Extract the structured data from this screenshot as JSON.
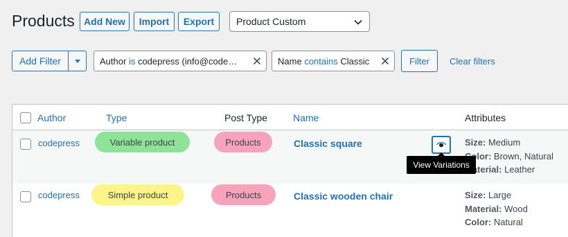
{
  "header": {
    "title": "Products",
    "add_new": "Add New",
    "import": "Import",
    "export": "Export",
    "view_select": "Product Custom"
  },
  "filters": {
    "add_filter": "Add Filter",
    "chips": [
      {
        "field": "Author",
        "operator": "is",
        "value": "codepress (info@code…"
      },
      {
        "field": "Name",
        "operator": "contains",
        "value": "Classic"
      }
    ],
    "filter_button": "Filter",
    "clear_filters": "Clear filters"
  },
  "table": {
    "columns": [
      "Author",
      "Type",
      "Post Type",
      "Name",
      "Attributes"
    ],
    "rows": [
      {
        "author": "codepress",
        "type": "Variable product",
        "post_type": "Products",
        "name": "Classic square",
        "attributes": [
          {
            "label": "Size:",
            "value": "Medium"
          },
          {
            "label": "Color:",
            "value": "Brown, Natural"
          },
          {
            "label": "Material:",
            "value": "Leather"
          }
        ]
      },
      {
        "author": "codepress",
        "type": "Simple product",
        "post_type": "Products",
        "name": "Classic wooden chair",
        "attributes": [
          {
            "label": "Size:",
            "value": "Large"
          },
          {
            "label": "Material:",
            "value": "Wood"
          },
          {
            "label": "Color:",
            "value": "Natural"
          }
        ]
      }
    ],
    "tooltip": "View Variations"
  },
  "colors": {
    "accent": "#2271b1",
    "variable_pill": "#8fe398",
    "simple_pill": "#fcf58a",
    "post_type_pill": "#f7a3bb"
  },
  "icons": [
    "chevron-down-icon",
    "caret-down-icon",
    "close-icon",
    "eye-icon"
  ]
}
